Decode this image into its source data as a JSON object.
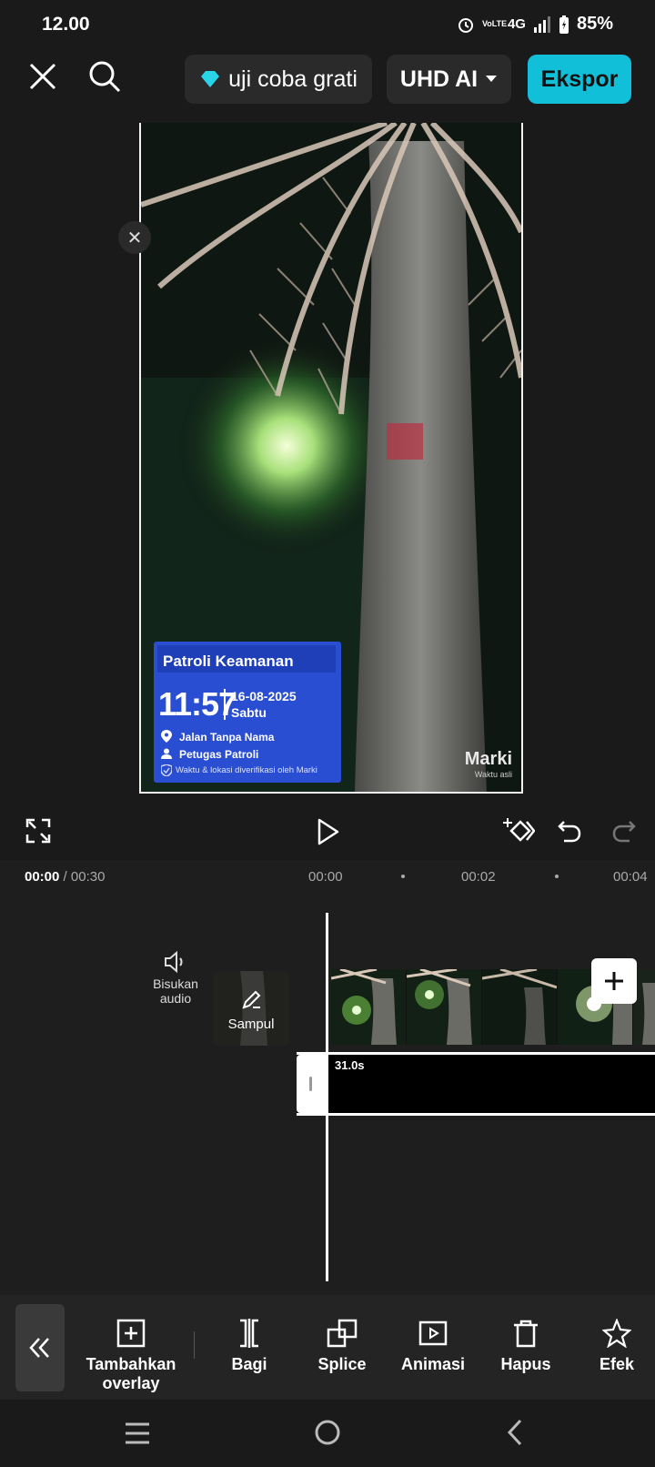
{
  "status_bar": {
    "time": "12.00",
    "network": "4G",
    "volte": "VoLTE",
    "battery": "85%"
  },
  "top_bar": {
    "trial_label": "uji coba grati",
    "quality_label": "UHD AI",
    "export_label": "Ekspor"
  },
  "overlay_card": {
    "title": "Patroli Keamanan",
    "time": "11:57",
    "date": "16-08-2025",
    "day": "Sabtu",
    "location": "Jalan Tanpa Nama",
    "officer": "Petugas Patroli",
    "verified": "Waktu & lokasi diverifikasi oleh Marki"
  },
  "watermark": {
    "brand": "Marki",
    "subtitle": "Waktu asli"
  },
  "timeline": {
    "current": "00:00",
    "total": "/ 00:30",
    "ticks": [
      "00:00",
      "00:02",
      "00:04"
    ],
    "mute_label": "Bisukan audio",
    "cover_label": "Sampul",
    "overlay_duration": "31.0s"
  },
  "toolbar": {
    "items": [
      {
        "label": "Tambahkan overlay",
        "icon": "add-overlay-icon"
      },
      {
        "label": "Bagi",
        "icon": "split-icon"
      },
      {
        "label": "Splice",
        "icon": "splice-icon"
      },
      {
        "label": "Animasi",
        "icon": "animation-icon"
      },
      {
        "label": "Hapus",
        "icon": "delete-icon"
      },
      {
        "label": "Efek",
        "icon": "effect-icon"
      }
    ]
  },
  "colors": {
    "accent": "#11c0d8",
    "overlay_card": "#2a4ed1",
    "background": "#1a1a1a"
  }
}
